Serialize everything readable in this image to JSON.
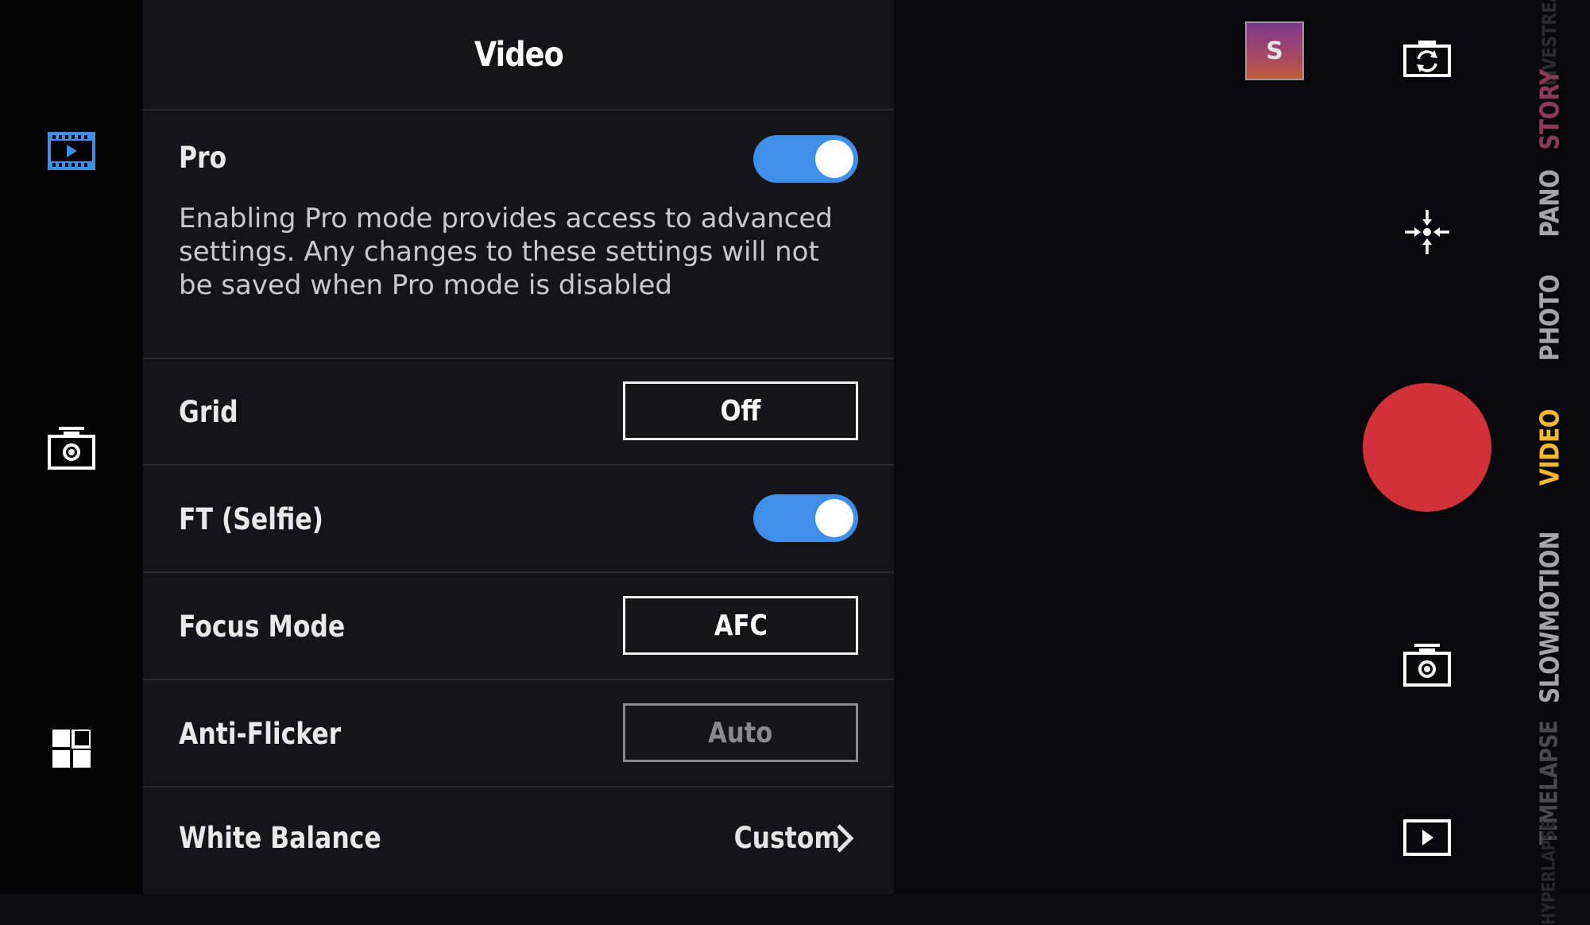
{
  "panel": {
    "title": "Video"
  },
  "settings": {
    "pro": {
      "label": "Pro",
      "enabled": true,
      "description": "Enabling Pro mode provides access to advanced settings. Any changes to these settings will not be saved when Pro mode is disabled"
    },
    "grid": {
      "label": "Grid",
      "value": "Off"
    },
    "ft_selfie": {
      "label": "FT (Selfie)",
      "enabled": true
    },
    "focus_mode": {
      "label": "Focus Mode",
      "value": "AFC"
    },
    "anti_flicker": {
      "label": "Anti-Flicker",
      "value": "Auto"
    },
    "white_balance": {
      "label": "White Balance",
      "value": "Custom"
    }
  },
  "left_rail": {
    "icons": [
      "video-settings-icon",
      "camera-settings-icon",
      "grid-layout-icon"
    ]
  },
  "camera": {
    "thumbnail_letter": "S",
    "modes": [
      "LIVESTREAM",
      "STORY",
      "PANO",
      "PHOTO",
      "VIDEO",
      "SLOWMOTION",
      "TIMELAPSE",
      "HYPERLAPSE"
    ],
    "active_mode": "VIDEO",
    "shutter_color": "#d1313a"
  },
  "colors": {
    "accent": "#3f8fe8",
    "active_mode": "#f5b82e",
    "story_mode": "#8b3b57"
  }
}
